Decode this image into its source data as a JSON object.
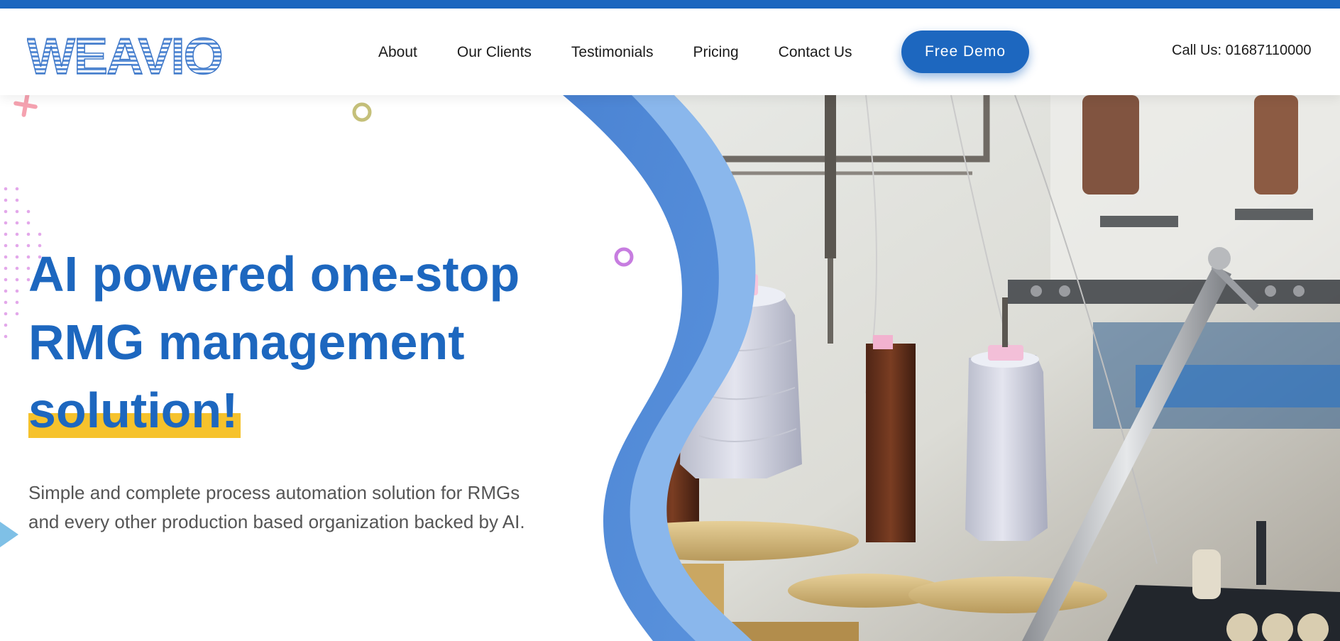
{
  "brand": {
    "logo_text": "WEAVIO"
  },
  "nav": {
    "items": [
      "About",
      "Our Clients",
      "Testimonials",
      "Pricing",
      "Contact Us"
    ]
  },
  "cta": {
    "free_demo": "Free Demo"
  },
  "contact": {
    "call_label": "Call Us: 01687110000"
  },
  "hero": {
    "headline_line1": "AI powered one-stop",
    "headline_line2": "RMG management",
    "headline_highlight": "solution!",
    "subtitle": "Simple and complete process automation solution for RMGs and every other production based organization backed by AI."
  },
  "colors": {
    "brand_blue": "#1d67bf",
    "highlight_yellow": "#f6c22c",
    "wave_light_blue": "#8ab7ec",
    "text_grey": "#555555"
  },
  "icons": [
    "plus-shape",
    "ring-olive",
    "ring-purple",
    "dot-grid",
    "triangle-blue"
  ]
}
